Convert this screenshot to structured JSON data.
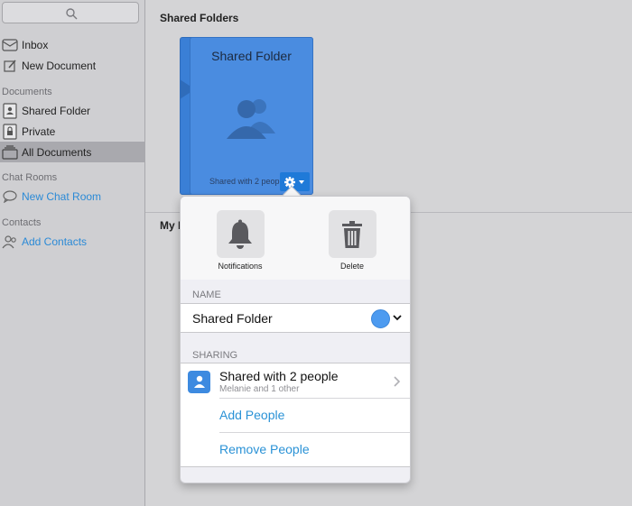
{
  "sidebar": {
    "search_icon": "magnifier-icon",
    "items": [
      {
        "label": "Inbox",
        "icon": "inbox-icon"
      },
      {
        "label": "New Document",
        "icon": "compose-icon"
      }
    ],
    "sections": [
      {
        "title": "Documents",
        "items": [
          {
            "label": "Shared Folder",
            "icon": "shared-folder-icon"
          },
          {
            "label": "Private",
            "icon": "lock-folder-icon"
          },
          {
            "label": "All Documents",
            "icon": "stack-icon",
            "selected": true
          }
        ]
      },
      {
        "title": "Chat Rooms",
        "items": [
          {
            "label": "New Chat Room",
            "icon": "chat-bubble-icon"
          }
        ]
      },
      {
        "title": "Contacts",
        "items": [
          {
            "label": "Add Contacts",
            "icon": "people-icon"
          }
        ]
      }
    ]
  },
  "main": {
    "title": "Shared Folders",
    "folder": {
      "title": "Shared Folder",
      "shared_text": "Shared with 2 people",
      "color": "#4a8ce0"
    },
    "second_label": "My D"
  },
  "popover": {
    "actions": [
      {
        "label": "Notifications",
        "icon": "bell-icon"
      },
      {
        "label": "Delete",
        "icon": "trash-icon"
      }
    ],
    "name_section": "NAME",
    "name_value": "Shared Folder",
    "folder_color": "#4d9bf0",
    "sharing_section": "SHARING",
    "shared_title": "Shared with 2 people",
    "shared_sub": "Melanie and 1 other",
    "add_people": "Add People",
    "remove_people": "Remove People"
  },
  "colors": {
    "accent": "#2a92d6",
    "folder_blue": "#4a8ce0",
    "gear_button": "#1f7ad8"
  }
}
